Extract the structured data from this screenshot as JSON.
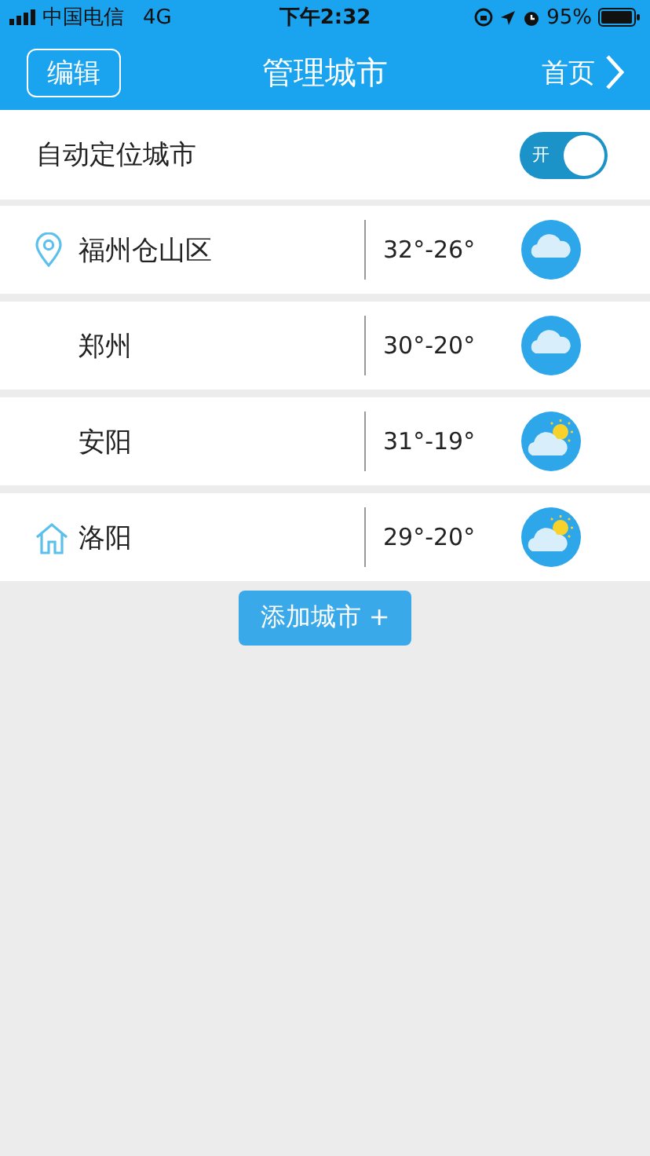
{
  "status_bar": {
    "carrier": "中国电信",
    "network": "4G",
    "time": "下午2:32",
    "battery": "95%"
  },
  "header": {
    "left_button": "编辑",
    "title": "管理城市",
    "right_link": "首页"
  },
  "auto_locate": {
    "label": "自动定位城市",
    "toggle_label": "开",
    "on": true
  },
  "cities": [
    {
      "name": "福州仓山区",
      "marker": {
        "kind": "location"
      },
      "temp": "32°-26°",
      "weather": {
        "kind": "cloudy"
      }
    },
    {
      "name": "郑州",
      "temp": "30°-20°",
      "weather": {
        "kind": "cloudy"
      }
    },
    {
      "name": "安阳",
      "temp": "31°-19°",
      "weather": {
        "kind": "partly_cloudy"
      }
    },
    {
      "name": "洛阳",
      "marker": {
        "kind": "home"
      },
      "temp": "29°-20°",
      "weather": {
        "kind": "partly_cloudy"
      }
    }
  ],
  "add_button": "添加城市 +"
}
